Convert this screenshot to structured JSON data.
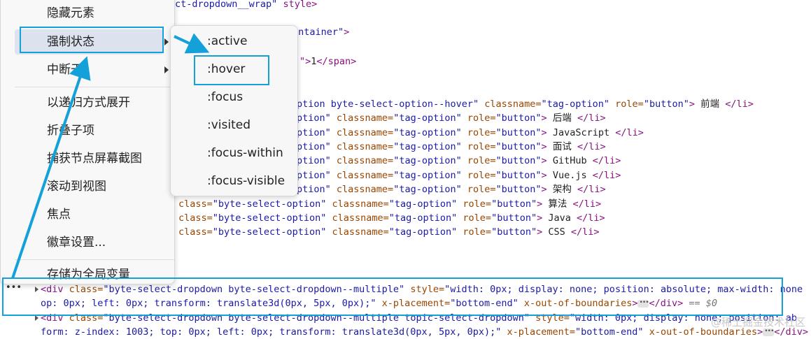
{
  "code_lines": [
    {
      "t": 1,
      "parts": [
        [
          "ct-dropdown__wrap\"",
          "val"
        ],
        [
          " style>",
          "tag"
        ]
      ]
    },
    {
      "t": 2,
      "parts": [
        [
          "ontainer\"",
          "val"
        ],
        [
          ">",
          "tag"
        ]
      ]
    },
    {
      "t": 3,
      "parts": [
        [
          "\">",
          "tag"
        ],
        [
          "1",
          "txt"
        ],
        [
          "</span>",
          "tag"
        ]
      ]
    },
    {
      "t": 4,
      "parts": [
        [
          "ption byte-select-option--hover\"",
          "val"
        ],
        [
          " classname=",
          "attr"
        ],
        [
          "\"tag-option\"",
          "val"
        ],
        [
          " role=",
          "attr"
        ],
        [
          "\"button\"",
          "val"
        ],
        [
          ">",
          "tag"
        ],
        [
          " 前端 ",
          "txt"
        ],
        [
          "</li>",
          "tag"
        ]
      ]
    },
    {
      "t": 5,
      "parts": [
        [
          "ption\"",
          "val"
        ],
        [
          " classname=",
          "attr"
        ],
        [
          "\"tag-option\"",
          "val"
        ],
        [
          " role=",
          "attr"
        ],
        [
          "\"button\"",
          "val"
        ],
        [
          ">",
          "tag"
        ],
        [
          " 后端 ",
          "txt"
        ],
        [
          "</li>",
          "tag"
        ]
      ]
    },
    {
      "t": 6,
      "parts": [
        [
          "ption\"",
          "val"
        ],
        [
          " classname=",
          "attr"
        ],
        [
          "\"tag-option\"",
          "val"
        ],
        [
          " role=",
          "attr"
        ],
        [
          "\"button\"",
          "val"
        ],
        [
          ">",
          "tag"
        ],
        [
          " JavaScript ",
          "txt"
        ],
        [
          "</li>",
          "tag"
        ]
      ]
    },
    {
      "t": 7,
      "parts": [
        [
          "ption\"",
          "val"
        ],
        [
          " classname=",
          "attr"
        ],
        [
          "\"tag-option\"",
          "val"
        ],
        [
          " role=",
          "attr"
        ],
        [
          "\"button\"",
          "val"
        ],
        [
          ">",
          "tag"
        ],
        [
          " 面试 ",
          "txt"
        ],
        [
          "</li>",
          "tag"
        ]
      ]
    },
    {
      "t": 8,
      "parts": [
        [
          "ption\"",
          "val"
        ],
        [
          " classname=",
          "attr"
        ],
        [
          "\"tag-option\"",
          "val"
        ],
        [
          " role=",
          "attr"
        ],
        [
          "\"button\"",
          "val"
        ],
        [
          ">",
          "tag"
        ],
        [
          " GitHub ",
          "txt"
        ],
        [
          "</li>",
          "tag"
        ]
      ]
    },
    {
      "t": 9,
      "parts": [
        [
          "ption\"",
          "val"
        ],
        [
          " classname=",
          "attr"
        ],
        [
          "\"tag-option\"",
          "val"
        ],
        [
          " role=",
          "attr"
        ],
        [
          "\"button\"",
          "val"
        ],
        [
          ">",
          "tag"
        ],
        [
          " Vue.js ",
          "txt"
        ],
        [
          "</li>",
          "tag"
        ]
      ]
    },
    {
      "t": 10,
      "parts": [
        [
          "ption\"",
          "val"
        ],
        [
          " classname=",
          "attr"
        ],
        [
          "\"tag-option\"",
          "val"
        ],
        [
          " role=",
          "attr"
        ],
        [
          "\"button\"",
          "val"
        ],
        [
          ">",
          "tag"
        ],
        [
          " 架构 ",
          "txt"
        ],
        [
          "</li>",
          "tag"
        ]
      ]
    },
    {
      "t": 11,
      "parts": [
        [
          "class=",
          "attr"
        ],
        [
          "\"byte-select-option\"",
          "val"
        ],
        [
          " classname=",
          "attr"
        ],
        [
          "\"tag-option\"",
          "val"
        ],
        [
          " role=",
          "attr"
        ],
        [
          "\"button\"",
          "val"
        ],
        [
          ">",
          "tag"
        ],
        [
          " 算法 ",
          "txt"
        ],
        [
          "</li>",
          "tag"
        ]
      ]
    },
    {
      "t": 12,
      "parts": [
        [
          "class=",
          "attr"
        ],
        [
          "\"byte-select-option\"",
          "val"
        ],
        [
          " classname=",
          "attr"
        ],
        [
          "\"tag-option\"",
          "val"
        ],
        [
          " role=",
          "attr"
        ],
        [
          "\"button\"",
          "val"
        ],
        [
          ">",
          "tag"
        ],
        [
          " Java ",
          "txt"
        ],
        [
          "</li>",
          "tag"
        ]
      ]
    },
    {
      "t": 13,
      "parts": [
        [
          "class=",
          "attr"
        ],
        [
          "\"byte-select-option\"",
          "val"
        ],
        [
          " classname=",
          "attr"
        ],
        [
          "\"tag-option\"",
          "val"
        ],
        [
          " role=",
          "attr"
        ],
        [
          "\"button\"",
          "val"
        ],
        [
          ">",
          "tag"
        ],
        [
          " CSS ",
          "txt"
        ],
        [
          "</li>",
          "tag"
        ]
      ]
    },
    {
      "t": 14,
      "parts": [
        [
          "<div ",
          "tag"
        ],
        [
          "class=",
          "attr"
        ],
        [
          "\"byte-select-dropdown byte-select-dropdown--multiple\"",
          "val"
        ],
        [
          " style=",
          "attr"
        ],
        [
          "\"width: 0px; display: none; position: absolute; max-width: none",
          "val"
        ]
      ]
    },
    {
      "t": 15,
      "parts": [
        [
          "op: 0px; left: 0px; transform: translate3d(0px, 5px, 0px);\"",
          "val"
        ],
        [
          " x-placement=",
          "attr"
        ],
        [
          "\"bottom-end\"",
          "val"
        ],
        [
          " x-out-of-boundaries",
          "attr"
        ],
        [
          ">",
          "tag"
        ],
        [
          "ELLIPSIS",
          "ell"
        ],
        [
          "</div>",
          "tag"
        ],
        [
          " == $0",
          "eq"
        ]
      ]
    },
    {
      "t": 16,
      "parts": [
        [
          "<div ",
          "tag"
        ],
        [
          "class=",
          "attr"
        ],
        [
          "\"byte-select-dropdown byte-select-dropdown--multiple topic-select-dropdown\"",
          "val"
        ],
        [
          " style=",
          "attr"
        ],
        [
          "\"width: 0px; display: none; position: ab",
          "val"
        ]
      ]
    },
    {
      "t": 17,
      "parts": [
        [
          "form: z-index: 1003; top: 0px; left: 0px; transform: translate3d(0px, 5px, 0px);\"",
          "val"
        ],
        [
          " x-placement=",
          "attr"
        ],
        [
          "\"bottom-end\"",
          "val"
        ],
        [
          " x-out-of-boundaries",
          "attr"
        ],
        [
          ">",
          "tag"
        ],
        [
          "ELLIPSIS",
          "ell"
        ],
        [
          "</div>",
          "tag"
        ]
      ]
    }
  ],
  "menu": {
    "items": [
      {
        "label": "隐藏元素"
      },
      {
        "label": "强制状态"
      },
      {
        "label": "中断于"
      },
      {
        "label": "以递归方式展开"
      },
      {
        "label": "折叠子项"
      },
      {
        "label": "捕获节点屏幕截图"
      },
      {
        "label": "滚动到视图"
      },
      {
        "label": "焦点"
      },
      {
        "label": "徽章设置..."
      },
      {
        "label": "存储为全局变量"
      }
    ]
  },
  "submenu": {
    "items": [
      {
        "label": ":active"
      },
      {
        "label": ":hover"
      },
      {
        "label": ":focus"
      },
      {
        "label": ":visited"
      },
      {
        "label": ":focus-within"
      },
      {
        "label": ":focus-visible"
      }
    ]
  },
  "watermark": "@稀土掘金技术社区",
  "colors": {
    "accent": "#14a0d8",
    "tag": "#881280",
    "attr": "#994500",
    "value": "#1a1aa6"
  }
}
